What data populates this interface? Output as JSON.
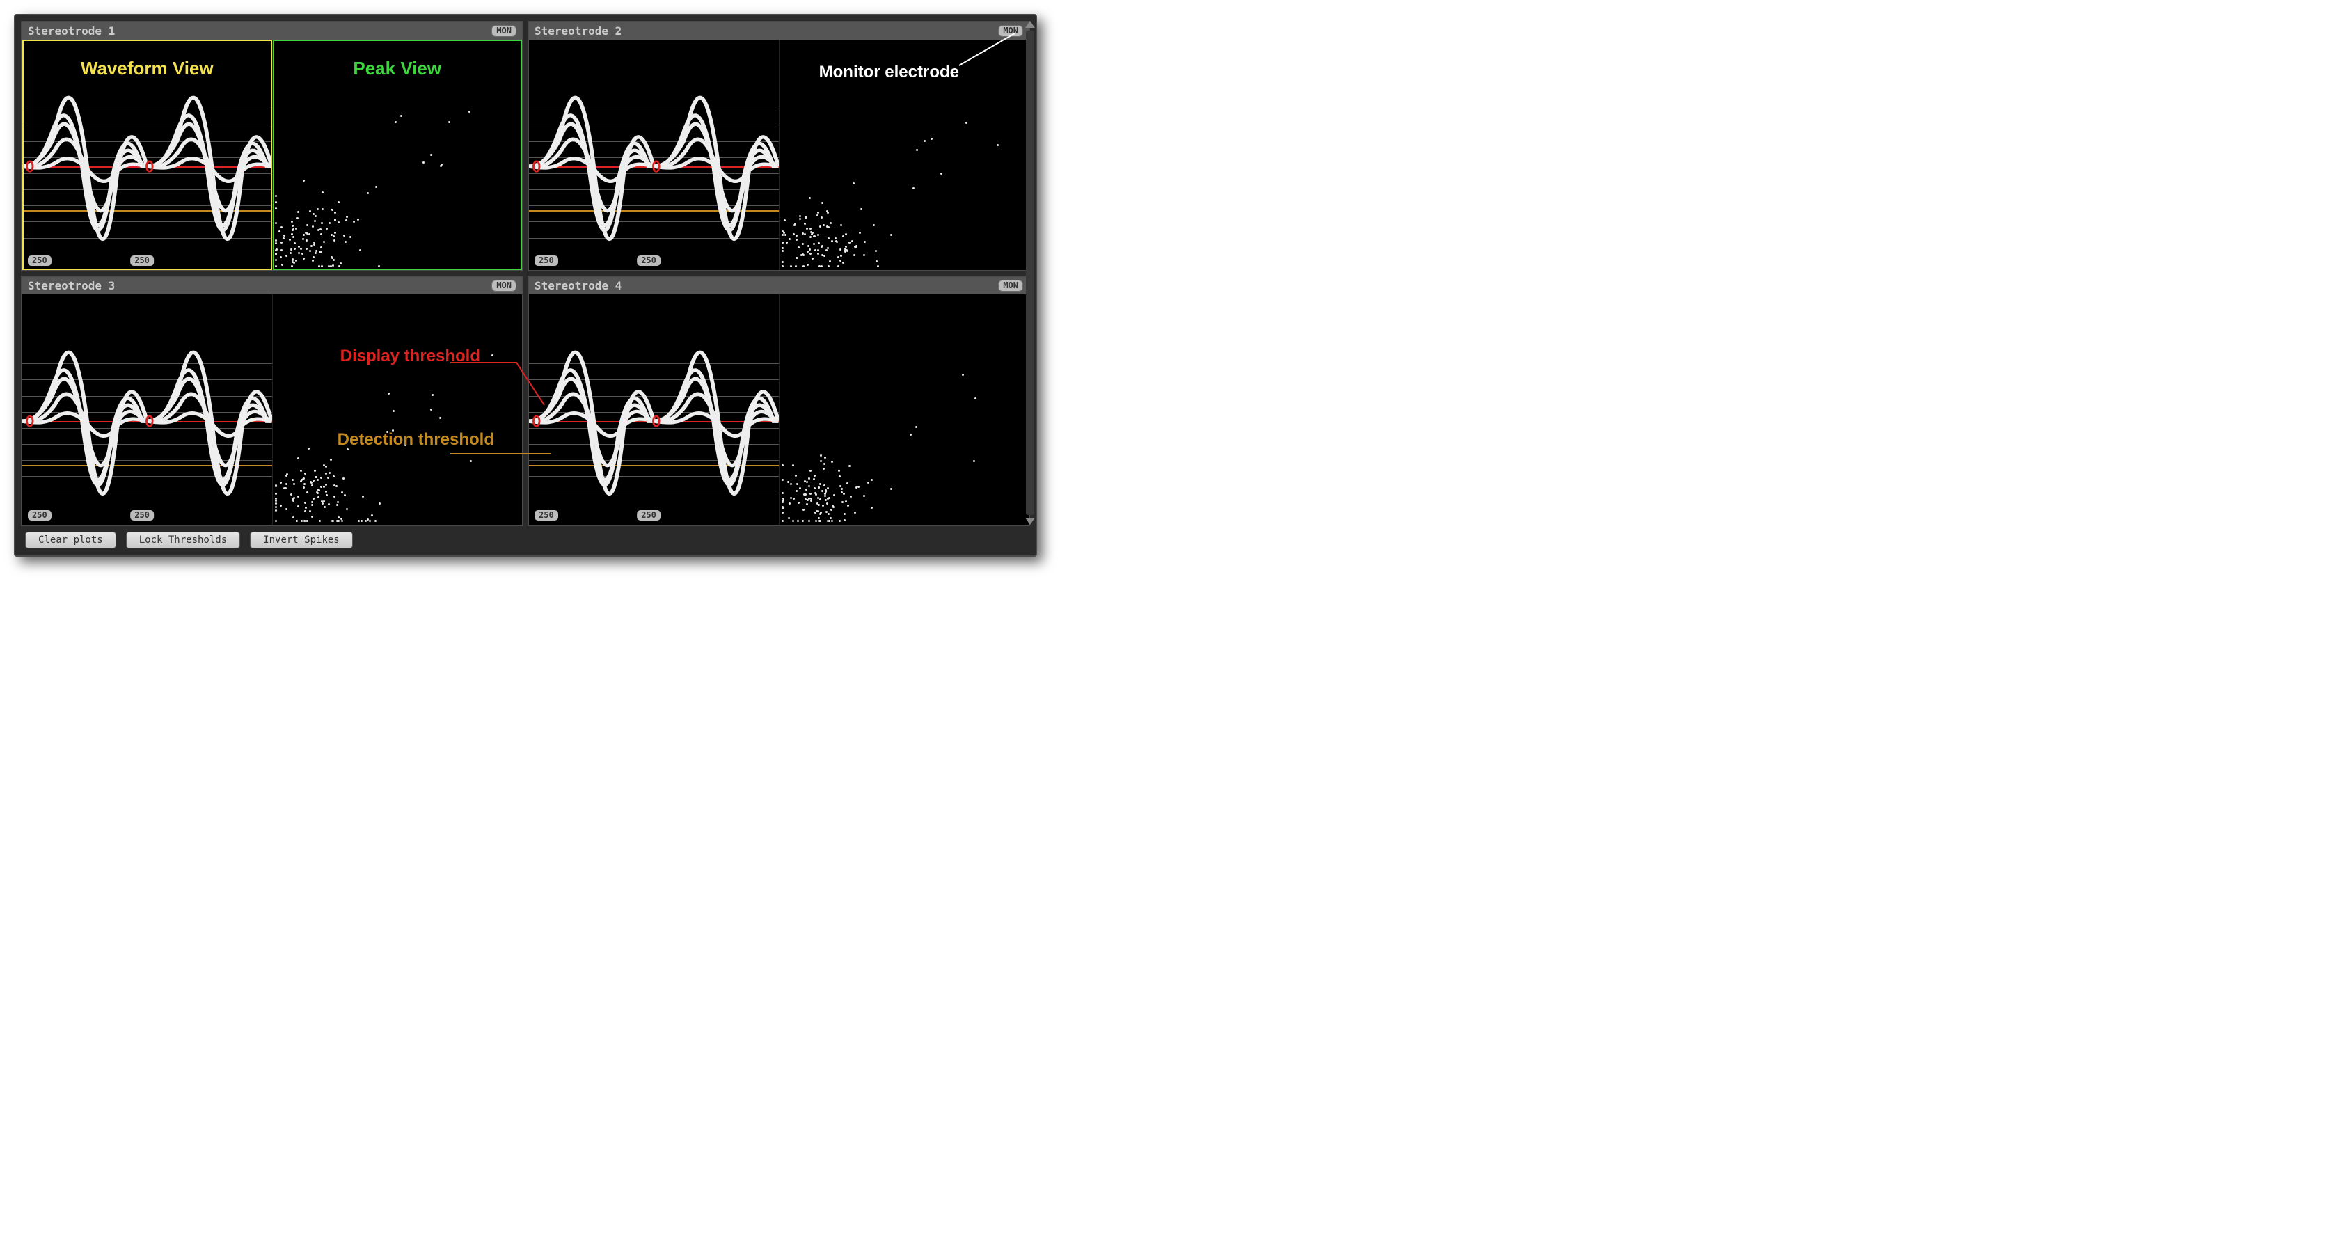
{
  "panels": [
    {
      "title": "Stereotrode 1",
      "mon": "MON",
      "gain_left": "250",
      "gain_mid": "250"
    },
    {
      "title": "Stereotrode 2",
      "mon": "MON",
      "gain_left": "250",
      "gain_mid": "250"
    },
    {
      "title": "Stereotrode 3",
      "mon": "MON",
      "gain_left": "250",
      "gain_mid": "250"
    },
    {
      "title": "Stereotrode 4",
      "mon": "MON",
      "gain_left": "250",
      "gain_mid": "250"
    }
  ],
  "annotations": {
    "waveform_view": "Waveform View",
    "peak_view": "Peak View",
    "monitor_electrode": "Monitor electrode",
    "display_threshold": "Display threshold",
    "detection_threshold": "Detection threshold"
  },
  "toolbar": {
    "clear_plots": "Clear plots",
    "lock_thresholds": "Lock Thresholds",
    "invert_spikes": "Invert Spikes"
  },
  "threshold_positions": {
    "red_pct": 55,
    "orange_pct": 74
  },
  "gridline_pcts": [
    30,
    37,
    44,
    51,
    58,
    65,
    72,
    79,
    86
  ],
  "waveforms": [
    "M0 55 C5 55 8 52 12 40 C16 28 20 30 24 55 C28 90 32 92 36 60 C40 40 44 42 48 55 L50 55",
    "M0 55 C6 55 10 50 14 35 C18 18 22 22 26 55 C30 95 34 98 38 58 C42 35 46 40 50 55",
    "M0 55 C5 56 9 54 13 48 C17 40 21 42 25 55 C29 78 33 82 37 58 C41 48 45 50 49 55 L50 55",
    "M0 55 C4 55 8 52 12 44 C16 32 20 34 24 55 C28 86 32 90 36 60 C40 44 44 46 48 55 L50 55",
    "M0 55 C6 56 10 56 14 53 C18 50 22 52 26 56 C30 62 34 64 38 57 C42 53 46 54 50 55"
  ],
  "colors": {
    "highlight_yellow": "#f3e24d",
    "highlight_green": "#3dd63d",
    "threshold_display": "#d22",
    "threshold_detection": "#c48a1f"
  }
}
